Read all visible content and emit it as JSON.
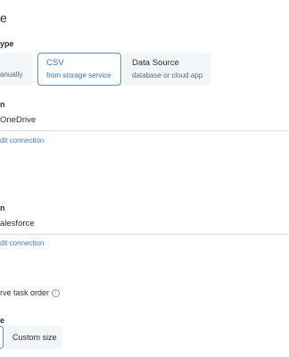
{
  "section1": {
    "heading": "e",
    "type_label": "ype",
    "options": [
      {
        "title": "",
        "sub": "anually"
      },
      {
        "title": "CSV",
        "sub": "from storage service"
      },
      {
        "title": "Data Source",
        "sub": "database or cloud app"
      }
    ],
    "location_label": "n",
    "location_value": "OneDrive",
    "edit_link": "dit connection"
  },
  "section2": {
    "heading": "",
    "location_label": "n",
    "location_value": "alesforce",
    "edit_link": "dit connection"
  },
  "options": {
    "checkbox_label": "rve task order",
    "info_glyph": "i",
    "size_label": "e",
    "custom_size": "Custom size"
  }
}
